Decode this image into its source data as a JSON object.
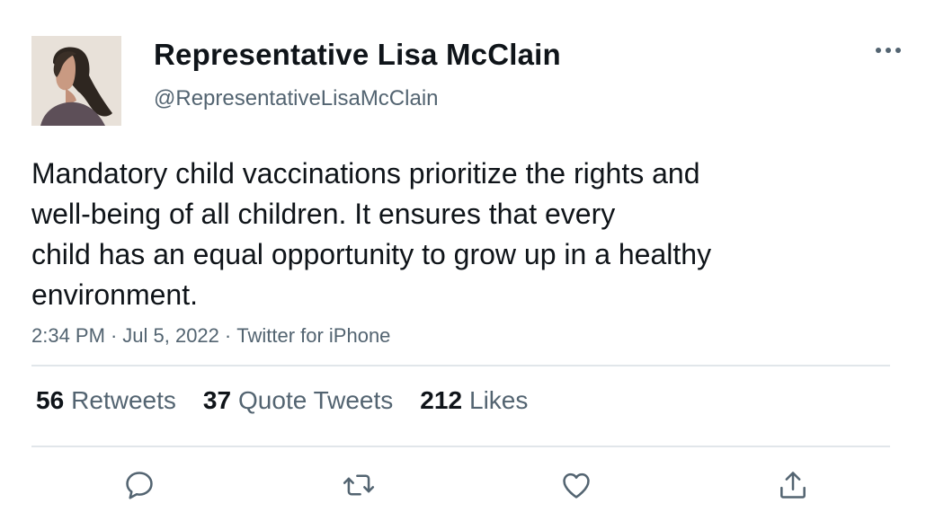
{
  "tweet": {
    "author_name": "Representative Lisa McClain",
    "author_handle": "@RepresentativeLisaMcClain",
    "text_lines": [
      "Mandatory child vaccinations prioritize the rights and",
      "well-being of all children. It ensures that every",
      "child has an equal opportunity to grow up in a healthy",
      "environment."
    ],
    "time": "2:34 PM",
    "date": "Jul 5, 2022",
    "source": "Twitter for iPhone",
    "separator": "·"
  },
  "stats": {
    "retweets": {
      "count": "56",
      "label": "Retweets"
    },
    "quote_tweets": {
      "count": "37",
      "label": "Quote Tweets"
    },
    "likes": {
      "count": "212",
      "label": "Likes"
    }
  },
  "icons": {
    "more": "more-horizontal-icon",
    "reply": "reply-icon",
    "retweet": "retweet-icon",
    "like": "heart-icon",
    "share": "share-icon"
  },
  "colors": {
    "text": "#0f1419",
    "secondary": "#536471",
    "divider": "#e1e6ea",
    "background": "#ffffff"
  }
}
